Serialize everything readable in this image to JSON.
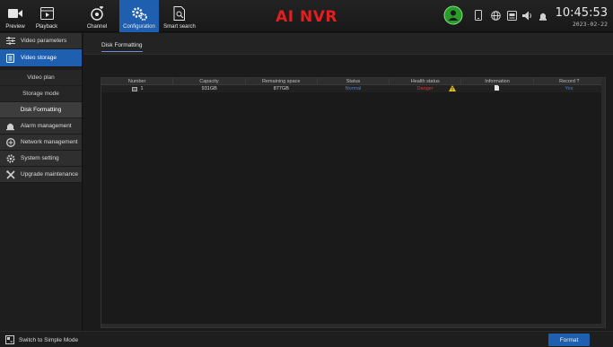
{
  "nav": {
    "preview": "Preview",
    "playback": "Playback",
    "channel": "Channel",
    "configuration": "Configuration",
    "smart_search": "Smart search"
  },
  "brand": "AI NVR",
  "clock": {
    "time": "10:45:53",
    "date": "2023-02-22"
  },
  "sidebar": {
    "items": [
      {
        "label": "Video parameters",
        "icon": "video-parameters-icon"
      },
      {
        "label": "Video storage",
        "icon": "video-storage-icon",
        "active": true
      },
      {
        "label": "Alarm management",
        "icon": "bell-icon"
      },
      {
        "label": "Network management",
        "icon": "globe-icon"
      },
      {
        "label": "System setting",
        "icon": "gear-icon"
      },
      {
        "label": "Upgrade maintenance",
        "icon": "wrench-icon"
      }
    ],
    "subitems": [
      "Video plan",
      "Storage mode",
      "Disk Formatting"
    ]
  },
  "tabs": {
    "active": "Disk Formatting"
  },
  "table": {
    "columns": [
      "Number",
      "Capacity",
      "Remaining space",
      "Status",
      "Health status",
      "Information",
      "Record ?"
    ],
    "rows": [
      {
        "number": "1",
        "capacity": "931GB",
        "remaining": "877GB",
        "status": "Normal",
        "health": "Danger",
        "record": "Yes"
      }
    ]
  },
  "bottom": {
    "simple_mode": "Switch to Simple Mode",
    "format": "Format"
  },
  "colors": {
    "accent": "#1f5fb0",
    "brand": "#e02020",
    "status_normal": "#4a7fd6",
    "health_danger": "#e03030",
    "record_yes": "#4a7fd6"
  }
}
